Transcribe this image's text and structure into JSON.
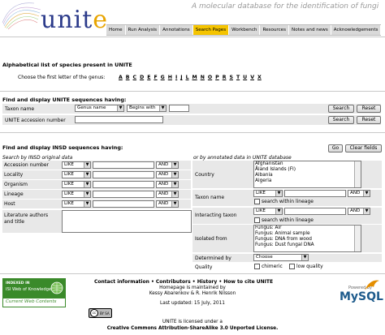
{
  "header": {
    "logo_text": "unit",
    "logo_e": "e",
    "tagline": "A molecular database for the identification of fungi",
    "nav": [
      "Home",
      "Run Analysis",
      "Annotations",
      "Search Pages",
      "Workbench",
      "Resources",
      "Notes and news",
      "Acknowledgements"
    ],
    "nav_active": 3
  },
  "alpha": {
    "title": "Alphabetical list of species present in UNITE",
    "prompt": "Choose the first letter of the genus:",
    "letters": [
      "A",
      "B",
      "C",
      "D",
      "E",
      "F",
      "G",
      "H",
      "I",
      "J",
      "L",
      "M",
      "N",
      "O",
      "P",
      "R",
      "S",
      "T",
      "U",
      "V",
      "X"
    ]
  },
  "unite_seq": {
    "title": "Find and display UNITE sequences having:",
    "taxon_label": "Taxon name",
    "taxon_field": "Genus name",
    "taxon_op": "Begins with",
    "accession_label": "UNITE accession number",
    "search": "Search",
    "reset": "Reset"
  },
  "insd": {
    "title": "Find and display INSD sequences having:",
    "go": "Go",
    "clear": "Clear fields",
    "left_caption": "Search by INSD original data",
    "right_caption": "or by annotated data in UNITE database",
    "left_rows": [
      {
        "label": "Accession number",
        "op": "LIKE",
        "conj": "AND"
      },
      {
        "label": "Locality",
        "op": "LIKE",
        "conj": "AND"
      },
      {
        "label": "Organism",
        "op": "LIKE",
        "conj": "AND"
      },
      {
        "label": "Lineage",
        "op": "LIKE",
        "conj": "AND"
      },
      {
        "label": "Host",
        "op": "LIKE",
        "conj": "AND"
      }
    ],
    "literature_label": "Literature authors and title",
    "country_label": "Country",
    "countries": [
      "Afghanistan",
      "Åland Islands (FI)",
      "Albania",
      "Algeria"
    ],
    "taxon_label": "Taxon name",
    "interacting_label": "Interacting taxon",
    "like": "LIKE",
    "and": "AND",
    "within_lineage": "search within lineage",
    "isolated_label": "Isolated from",
    "isolated": [
      "Fungus: Air",
      "Fungus: Animal sample",
      "Fungus: DNA from wood",
      "Fungus: Dust fungal DNA"
    ],
    "determined_label": "Determined by",
    "determined_value": "Choose",
    "quality_label": "Quality",
    "chimeric": "chimeric",
    "low_quality": "low quality"
  },
  "footer": {
    "links": [
      "Contact information",
      "Contributors",
      "History",
      "How to cite UNITE"
    ],
    "separator": "•",
    "maintained": "Homepage is maintained by",
    "maintainers": "Kessy Abarenkov & R. Henrik Nilsson",
    "updated": "Last updated: 15 July, 2011",
    "isi_top": "INDEXED IN",
    "isi_name": "ISI Web of Knowledge℠",
    "isi_sub": "Current Web Contents",
    "powered": "Powered by",
    "mysql": "MySQL",
    "license_line1": "UNITE is licensed under a",
    "license_line2": "Creative Commons Attribution-ShareAlike 3.0 Unported License.",
    "cc_label": "cc",
    "cc_by": "BY SA"
  },
  "colors": {
    "nav_active": "#f5c400",
    "logo_blue": "#2b3a8a",
    "isi_green": "#3a8a2a",
    "mysql_blue": "#1e5b8c"
  }
}
